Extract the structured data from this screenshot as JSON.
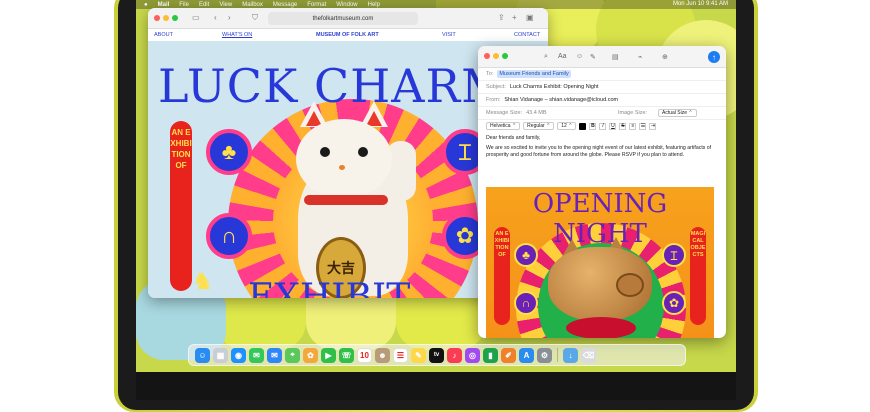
{
  "menubar": {
    "apple_logo": "",
    "items": [
      "Mail",
      "File",
      "Edit",
      "View",
      "Mailbox",
      "Message",
      "Format",
      "Window",
      "Help"
    ],
    "clock": "Mon Jun 10  9:41 AM"
  },
  "safari": {
    "url": "thefolkartmuseum.com",
    "nav": {
      "about": "ABOUT",
      "whats_on": "WHAT'S ON",
      "museum": "MUSEUM OF FOLK ART",
      "visit": "VISIT",
      "contact": "CONTACT"
    },
    "poster": {
      "title": "LUCK CHARMS",
      "bottom_text": "EXHIBIT",
      "banner_left": "AN EXHIBITION OF",
      "coin_text": "大吉"
    }
  },
  "mail": {
    "to_label": "To:",
    "to_value": "Museum Friends and Family",
    "subject_label": "Subject:",
    "subject_value": "Luck Charms Exhibit: Opening Night",
    "from_label": "From:",
    "from_value": "Shian Vidanage – shian.vidanage@icloud.com",
    "message_size_label": "Message Size:",
    "message_size_value": "43.4 MB",
    "image_size_label": "Image Size:",
    "image_size_value": "Actual Size",
    "font": "Helvetica",
    "weight": "Regular",
    "size": "12",
    "body_greeting": "Dear friends and family,",
    "body_text": "We are so excited to invite you to the opening night event of our latest exhibit, featuring artifacts of prosperity and good fortune from around the globe. Please RSVP if you plan to attend.",
    "poster": {
      "title": "OPENING NIGHT",
      "banner_left": "AN EXHIBITION OF",
      "banner_right": "MAGICAL OBJECTS"
    }
  },
  "dock": {
    "icons": [
      {
        "name": "finder",
        "color": "#2a8cf0"
      },
      {
        "name": "launchpad",
        "color": "#c9ced6"
      },
      {
        "name": "safari",
        "color": "#1e90ff"
      },
      {
        "name": "messages",
        "color": "#34c759"
      },
      {
        "name": "mail",
        "color": "#2f86f6"
      },
      {
        "name": "maps",
        "color": "#5ac85a"
      },
      {
        "name": "photos",
        "color": "#f4a73a"
      },
      {
        "name": "facetime",
        "color": "#30c04a"
      },
      {
        "name": "phone",
        "color": "#30c04a"
      },
      {
        "name": "calendar",
        "color": "#ffffff"
      },
      {
        "name": "contacts",
        "color": "#b89b7a"
      },
      {
        "name": "reminders",
        "color": "#ffffff"
      },
      {
        "name": "notes",
        "color": "#ffd84a"
      },
      {
        "name": "tv",
        "color": "#111111"
      },
      {
        "name": "music",
        "color": "#fb3c55"
      },
      {
        "name": "podcasts",
        "color": "#a04af0"
      },
      {
        "name": "numbers",
        "color": "#1ea24a"
      },
      {
        "name": "pages",
        "color": "#f0802a"
      },
      {
        "name": "app-store",
        "color": "#2a8cf0"
      },
      {
        "name": "system-settings",
        "color": "#8a8e96"
      },
      {
        "name": "downloads",
        "color": "#5aa8e8"
      },
      {
        "name": "trash",
        "color": "#d8dade"
      }
    ],
    "calendar_day": "10",
    "tv_label": "tv"
  }
}
